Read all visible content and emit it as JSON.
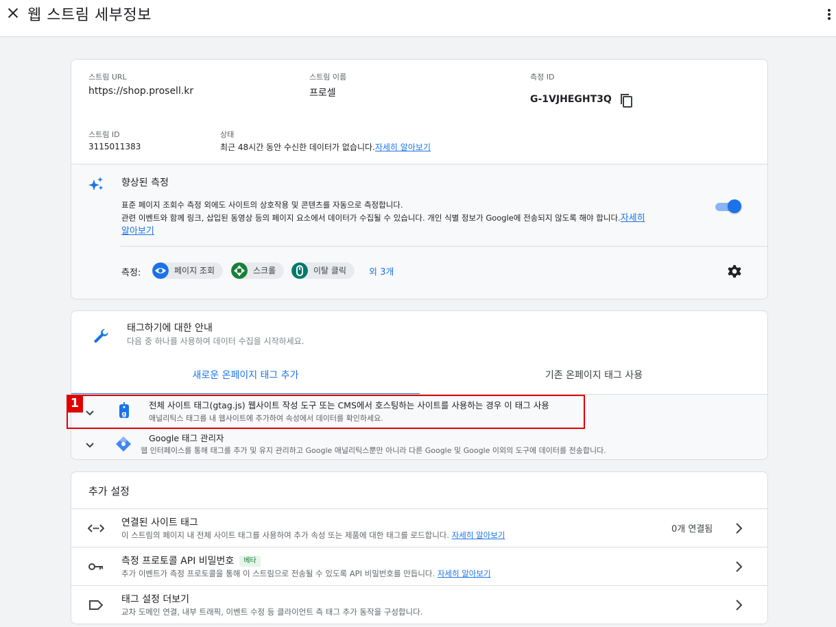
{
  "header": {
    "title": "웹 스트림 세부정보"
  },
  "stream": {
    "url_label": "스트림 URL",
    "url": "https://shop.prosell.kr",
    "name_label": "스트림 이름",
    "name": "프로셀",
    "measurement_label": "측정 ID",
    "measurement_id": "G-1VJHEGHT3Q",
    "id_label": "스트림 ID",
    "id": "3115011383",
    "status_label": "상태",
    "status_text": "최근 48시간 동안 수신한 데이터가 없습니다.",
    "status_link": "자세히 알아보기"
  },
  "enhanced": {
    "title": "향상된 측정",
    "desc_line1": "표준 페이지 조회수 측정 외에도 사이트의 상호작용 및 콘텐츠를 자동으로 측정합니다.",
    "desc_line2": "관련 이벤트와 함께 링크, 삽입된 동영상 등의 페이지 요소에서 데이터가 수집될 수 있습니다. 개인 식별 정보가 Google에 전송되지 않도록 해야 합니다.",
    "link_part1": "자세히",
    "link_part2": "알아보기",
    "toggle_on": true,
    "measure_label": "측정:",
    "chips": [
      "페이지 조회",
      "스크롤",
      "이탈 클릭"
    ],
    "more_label": "외 3개",
    "accent": "#1a73e8"
  },
  "tagging": {
    "title": "태그하기에 대한 안내",
    "subtitle": "다음 중 하나를 사용하여 데이터 수집을 시작하세요.",
    "tabs": [
      "새로운 온페이지 태그 추가",
      "기존 온페이지 태그 사용"
    ],
    "options": [
      {
        "title": "전체 사이트 태그(gtag.js) 웹사이트 작성 도구 또는 CMS에서 호스팅하는 사이트를 사용하는 경우 이 태그 사용",
        "desc": "애널리틱스 태그를 내 웹사이트에 추가하여 속성에서 데이터를 확인하세요."
      },
      {
        "title": "Google 태그 관리자",
        "desc": "웹 인터페이스를 통해 태그를 추가 및 유지 관리하고 Google 애널리틱스뿐만 아니라 다른 Google 및 Google 이외의 도구에 데이터를 전송합니다."
      }
    ]
  },
  "additional": {
    "title": "추가 설정",
    "rows": [
      {
        "title": "연결된 사이트 태그",
        "desc": "이 스트림의 페이지 내 전체 사이트 태그를 사용하여 추가 속성 또는 제품에 대한 태그를 로드합니다. ",
        "link": "자세히 알아보기",
        "meta": "0개 연결됨"
      },
      {
        "title": "측정 프로토콜 API 비밀번호",
        "badge": "베타",
        "desc": "추가 이벤트가 측정 프로토콜을 통해 이 스트림으로 전송될 수 있도록 API 비밀번호를 만듭니다. ",
        "link": "자세히 알아보기"
      },
      {
        "title": "태그 설정 더보기",
        "desc": "교차 도메인 연결, 내부 트래픽, 이벤트 수정 등 클라이언트 측 태그 추가 동작을 구성합니다."
      }
    ]
  },
  "annotation": {
    "number": "1",
    "color": "#e00000"
  }
}
